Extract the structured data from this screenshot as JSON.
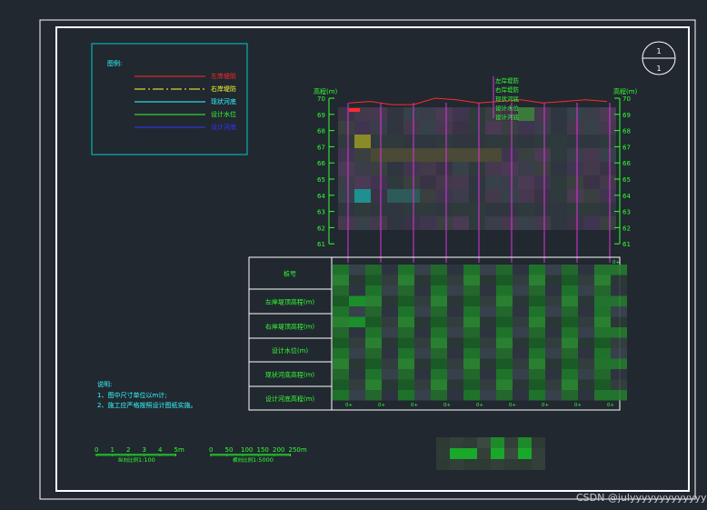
{
  "legend": {
    "title": "图例:",
    "items": [
      {
        "label": "左岸堤防",
        "line_color": "#ff2a2a",
        "label_color": "#ff2a2a",
        "dashed": false
      },
      {
        "label": "右岸堤防",
        "line_color": "#ffff33",
        "label_color": "#ffff33",
        "dashed": true
      },
      {
        "label": "现状河底",
        "line_color": "#33ffff",
        "label_color": "#33ffff",
        "dashed": false
      },
      {
        "label": "设计水位",
        "line_color": "#33ff33",
        "label_color": "#33ff33",
        "dashed": false
      },
      {
        "label": "设计河底",
        "line_color": "#3333ff",
        "label_color": "#3333ff",
        "dashed": false
      }
    ]
  },
  "compass": {
    "top": "1",
    "bottom": "1"
  },
  "profile": {
    "left_axis_title": "高程(m)",
    "right_axis_title": "高程(m)",
    "y_ticks": [
      "70",
      "69",
      "68",
      "67",
      "66",
      "65",
      "64",
      "63",
      "62",
      "61"
    ],
    "top_labels": [
      "左岸堤防",
      "右岸堤防",
      "现状河底",
      "设计水位",
      "设计河底"
    ],
    "left_bank_elevations": [
      69.7,
      69.8,
      69.6,
      69.6,
      70.0,
      69.9,
      69.7,
      69.8,
      69.9,
      69.7,
      69.8,
      69.9,
      69.8
    ]
  },
  "table": {
    "rows": [
      "桩号",
      "左岸堤顶高程(m)",
      "右岸堤顶高程(m)",
      "设计水位(m)",
      "现状河底高程(m)",
      "设计河底高程(m)"
    ],
    "bottom_tick_labels": [
      "0+",
      "0+",
      "0+",
      "0+",
      "0+",
      "0+",
      "0+",
      "0+",
      "0+"
    ],
    "top_right_tick": "0+"
  },
  "notes": {
    "title": "说明:",
    "lines": [
      "1、图中尺寸单位以m计;",
      "2、施工应严格按照设计图纸实施。"
    ]
  },
  "scale_bars": [
    {
      "ticks": [
        "0",
        "1",
        "2",
        "3",
        "4",
        "5m"
      ],
      "label": "纵向比例",
      "ratio": "1:100"
    },
    {
      "ticks": [
        "0",
        "50",
        "100",
        "150",
        "200",
        "250m"
      ],
      "label": "横向比例",
      "ratio": "1:5000"
    }
  ],
  "watermark": "CSDN @julyyyyyyyyyyyyyy",
  "colors": {
    "background": "#212830",
    "frame": "#ffffff",
    "legend_box": "#00cccc",
    "axis": "#33ff33",
    "station_line": "#dd33dd",
    "grid_fill": "#1fa82a"
  }
}
